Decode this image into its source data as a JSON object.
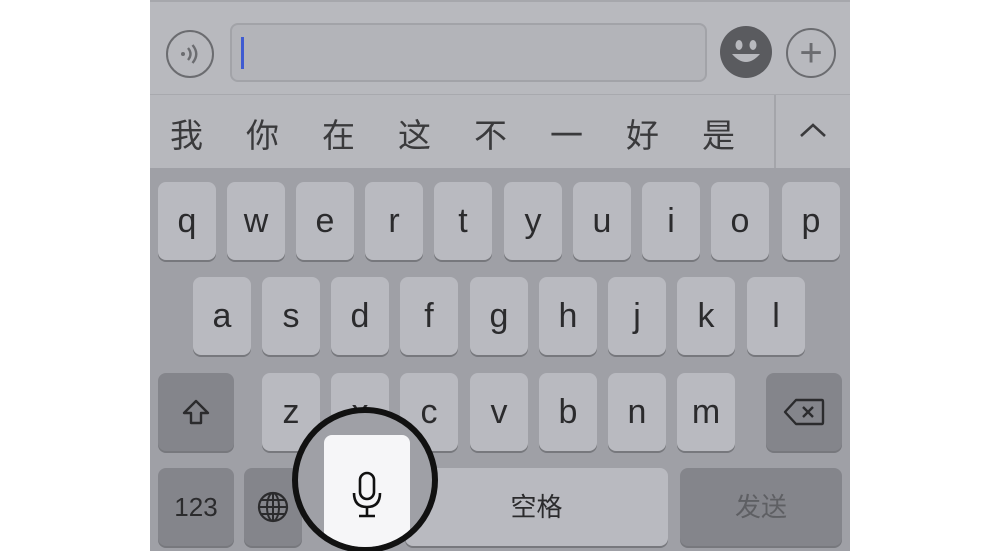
{
  "input_bar": {
    "voice_icon": "voice-wave-icon",
    "emoji_icon": "emoji-face-icon",
    "plus_label": "+"
  },
  "candidates": {
    "items": [
      "我",
      "你",
      "在",
      "这",
      "不",
      "一",
      "好",
      "是"
    ],
    "expand_icon": "chevron-up-icon"
  },
  "keyboard": {
    "row1": [
      "q",
      "w",
      "e",
      "r",
      "t",
      "y",
      "u",
      "i",
      "o",
      "p"
    ],
    "row2": [
      "a",
      "s",
      "d",
      "f",
      "g",
      "h",
      "j",
      "k",
      "l"
    ],
    "row3": [
      "z",
      "x",
      "c",
      "v",
      "b",
      "n",
      "m"
    ],
    "shift_icon": "shift-icon",
    "delete_icon": "delete-icon",
    "numbers_label": "123",
    "globe_icon": "globe-icon",
    "mic_icon": "microphone-icon",
    "space_label": "空格",
    "send_label": "发送"
  }
}
